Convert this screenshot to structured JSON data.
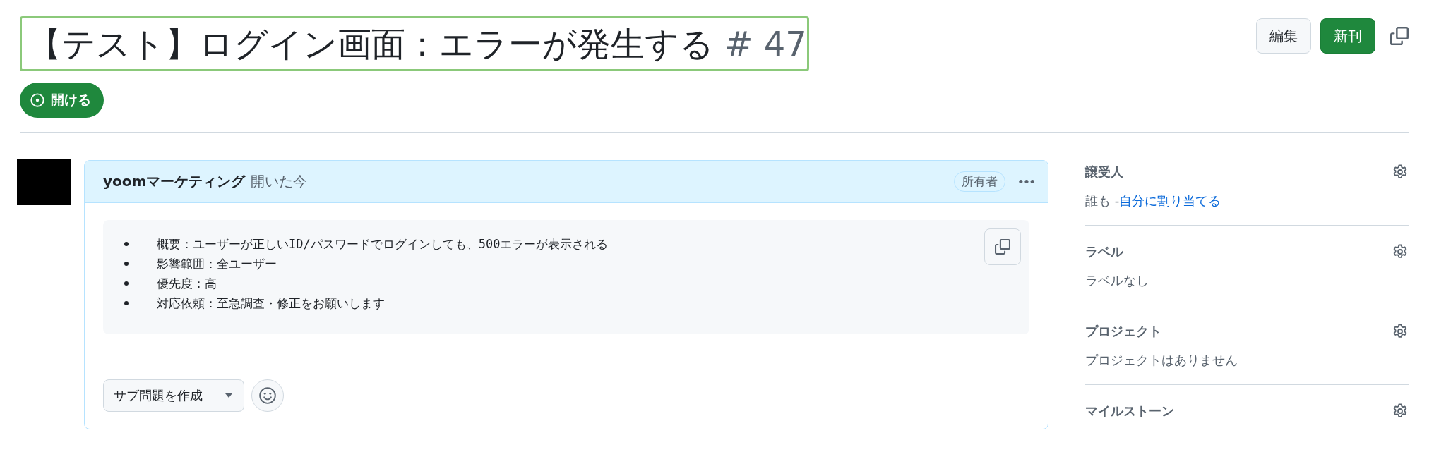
{
  "issue": {
    "title": "【テスト】ログイン画面：エラーが発生する",
    "number": "# 47"
  },
  "status": {
    "label": "開ける",
    "kind": "open"
  },
  "actions": [
    "編集",
    "新刊"
  ],
  "comment": {
    "author": "yoomマーケティング",
    "meta": "開いた今",
    "badge": "所有者",
    "items": [
      "概要：ユーザーが正しいID/パスワードでログインしても、500エラーが表示される",
      "影響範囲：全ユーザー",
      "優先度：高",
      "対応依頼：至急調査・修正をお願いします"
    ],
    "create_button": "サブ問題を作成"
  },
  "sidebar": [
    {
      "title": "譲受人",
      "value": "誰も -",
      "link": "自分に割り当てる"
    },
    {
      "title": "ラベル",
      "value": "ラベルなし"
    },
    {
      "title": "プロジェクト",
      "value": "プロジェクトはありません"
    },
    {
      "title": "マイルストーン"
    }
  ]
}
